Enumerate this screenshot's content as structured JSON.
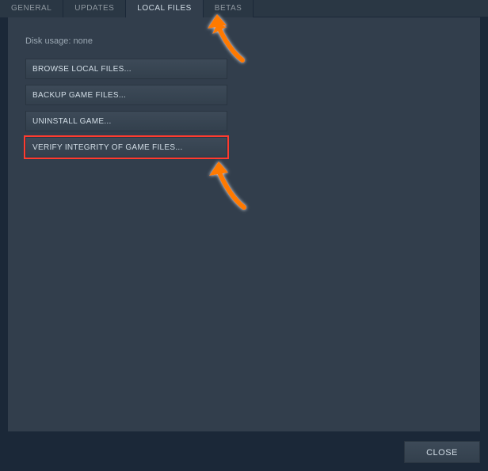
{
  "tabs": [
    {
      "label": "GENERAL",
      "active": false
    },
    {
      "label": "UPDATES",
      "active": false
    },
    {
      "label": "LOCAL FILES",
      "active": true
    },
    {
      "label": "BETAS",
      "active": false
    }
  ],
  "disk_usage_label": "Disk usage: none",
  "buttons": {
    "browse": "BROWSE LOCAL FILES...",
    "backup": "BACKUP GAME FILES...",
    "uninstall": "UNINSTALL GAME...",
    "verify": "VERIFY INTEGRITY OF GAME FILES..."
  },
  "close_label": "CLOSE",
  "annotation": {
    "highlight_color": "#ff3b2f",
    "arrow_color": "#ff7a00"
  }
}
